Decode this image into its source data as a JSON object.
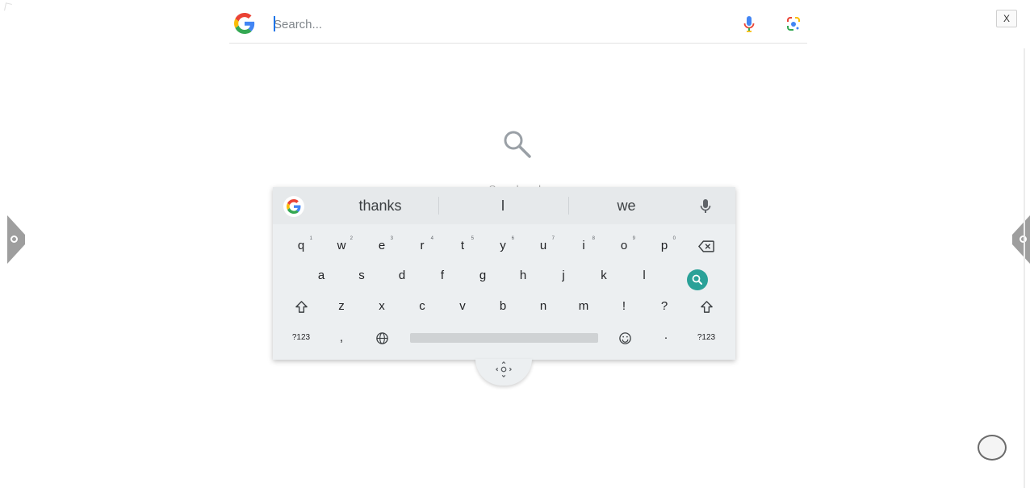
{
  "search_bar": {
    "placeholder": "Search...",
    "value": "",
    "logo_icon": "google-g-icon",
    "mic_icon": "microphone-icon",
    "lens_icon": "google-lens-icon"
  },
  "window": {
    "close_label": "X"
  },
  "center_hint": {
    "icon": "search-icon",
    "text": "Search web"
  },
  "keyboard": {
    "suggestions": [
      "thanks",
      "I",
      "we"
    ],
    "row1": [
      {
        "label": "q",
        "hint": "1"
      },
      {
        "label": "w",
        "hint": "2"
      },
      {
        "label": "e",
        "hint": "3"
      },
      {
        "label": "r",
        "hint": "4"
      },
      {
        "label": "t",
        "hint": "5"
      },
      {
        "label": "y",
        "hint": "6"
      },
      {
        "label": "u",
        "hint": "7"
      },
      {
        "label": "i",
        "hint": "8"
      },
      {
        "label": "o",
        "hint": "9"
      },
      {
        "label": "p",
        "hint": "0"
      }
    ],
    "row2": [
      "a",
      "s",
      "d",
      "f",
      "g",
      "h",
      "j",
      "k",
      "l"
    ],
    "row3": [
      "z",
      "x",
      "c",
      "v",
      "b",
      "n",
      "m",
      "!",
      "?"
    ],
    "row4": {
      "symbols_label": "?123",
      "comma": ",",
      "period": "·",
      "symbols_label_right": "?123"
    },
    "icons": {
      "backspace": "backspace-icon",
      "search": "search-icon",
      "shift": "shift-icon",
      "globe": "globe-icon",
      "emoji": "emoji-icon",
      "move": "move-handle-icon",
      "mic": "microphone-icon"
    }
  },
  "colors": {
    "accent_search_key": "#2aa198",
    "keyboard_bg": "#eceff1",
    "caret": "#1a73e8"
  }
}
